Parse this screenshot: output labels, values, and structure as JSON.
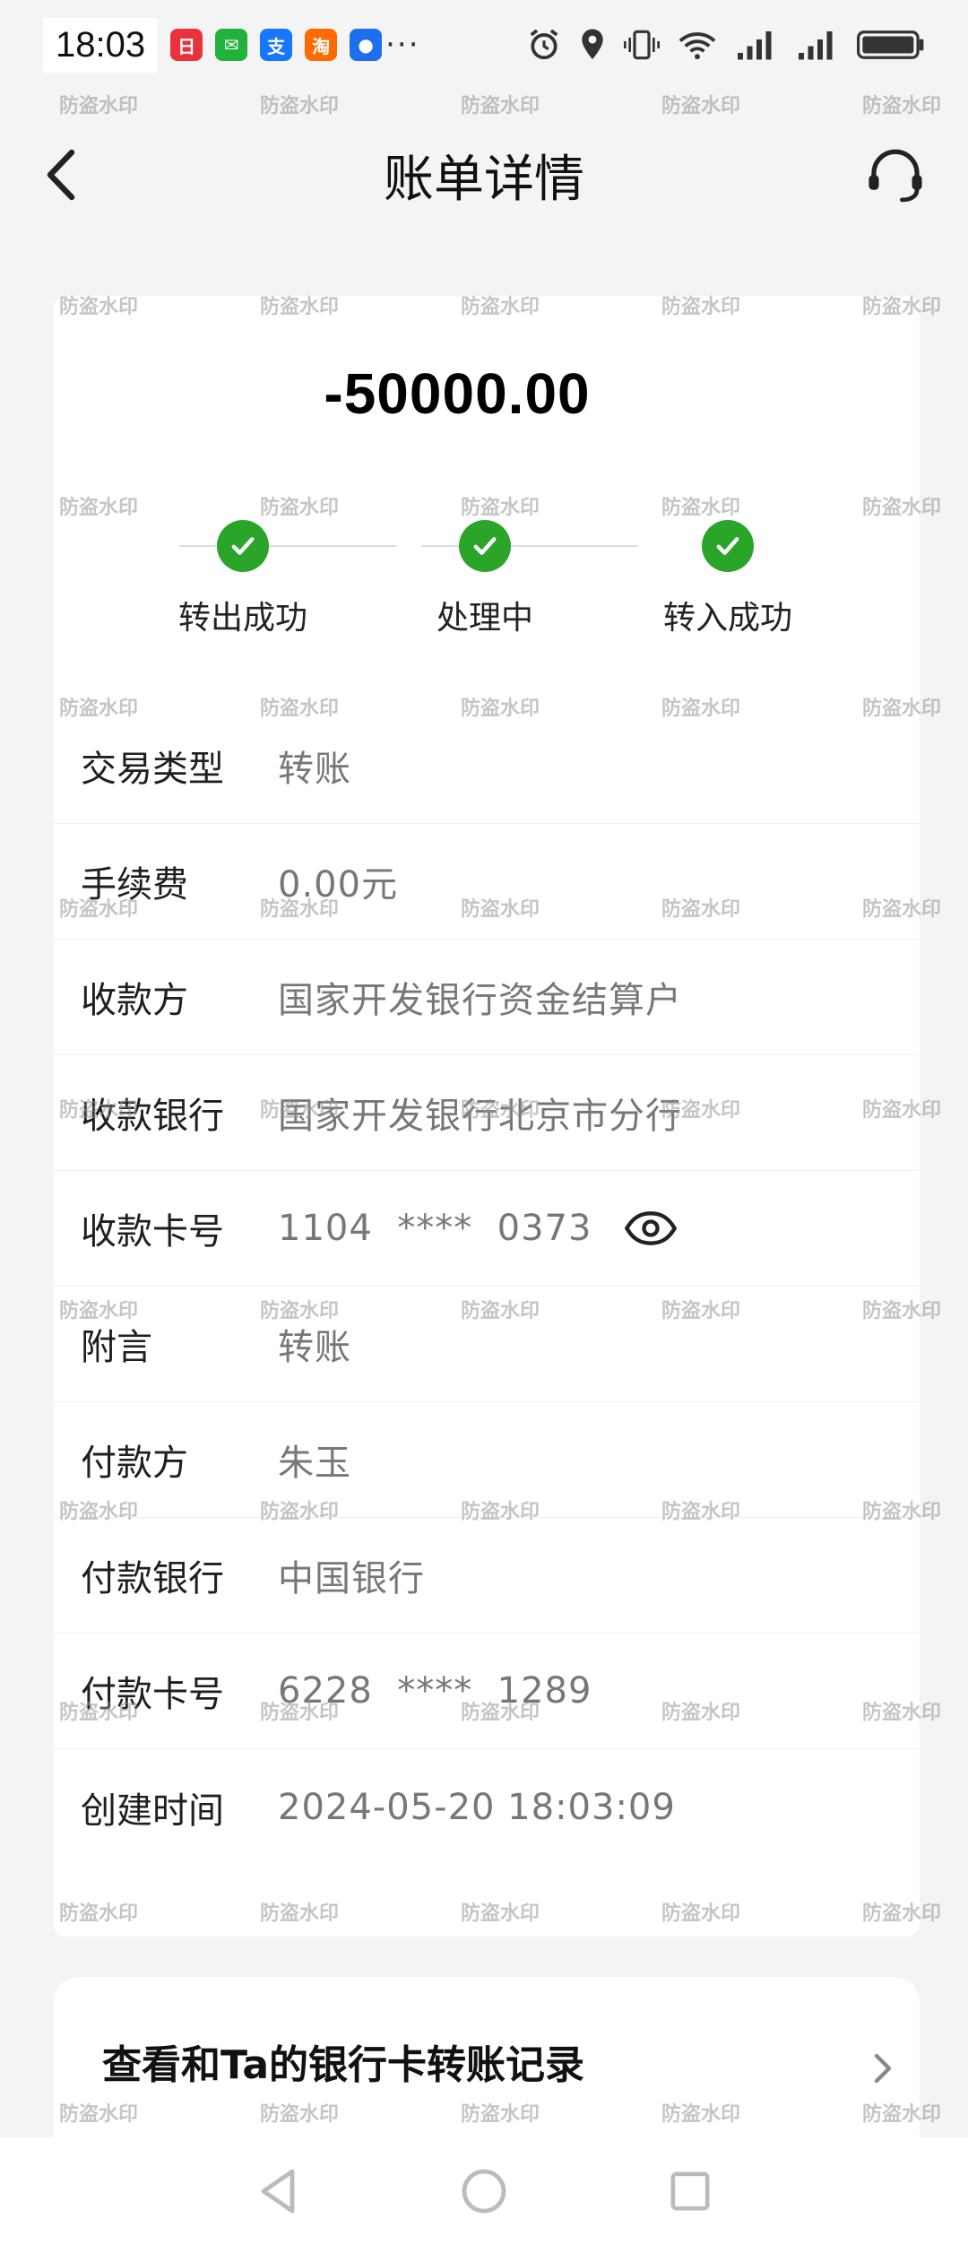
{
  "status_bar": {
    "time": "18:03",
    "app_icons": [
      {
        "name": "mall-app-icon",
        "color": "#e8333a",
        "glyph": "日"
      },
      {
        "name": "wechat-icon",
        "color": "#22b13a",
        "glyph": "✉"
      },
      {
        "name": "alipay-icon",
        "color": "#1677ff",
        "glyph": "支"
      },
      {
        "name": "taobao-icon",
        "color": "#ff6a00",
        "glyph": "淘"
      },
      {
        "name": "assistant-app-icon",
        "color": "#1e6ff0",
        "glyph": "●"
      }
    ],
    "more": "···"
  },
  "header": {
    "title": "账单详情"
  },
  "bill": {
    "amount": "-50000.00",
    "steps": [
      {
        "label": "转出成功"
      },
      {
        "label": "处理中"
      },
      {
        "label": "转入成功"
      }
    ],
    "rows": [
      {
        "label": "交易类型",
        "value": "转账"
      },
      {
        "label": "手续费",
        "value": "0.00元"
      },
      {
        "label": "收款方",
        "value": "国家开发银行资金结算户"
      },
      {
        "label": "收款银行",
        "value": "国家开发银行北京市分行"
      },
      {
        "label": "收款卡号",
        "value": "1104  ****  0373"
      },
      {
        "label": "附言",
        "value": "转账"
      },
      {
        "label": "付款方",
        "value": "朱玉"
      },
      {
        "label": "付款银行",
        "value": "中国银行"
      },
      {
        "label": "付款卡号",
        "value": "6228  ****  1289"
      },
      {
        "label": "创建时间",
        "value": "2024-05-20 18:03:09"
      }
    ]
  },
  "records": {
    "label": "查看和Ta的银行卡转账记录"
  },
  "watermark": {
    "text": "防盗水印"
  },
  "colors": {
    "success_green": "#2aa52a",
    "background": "#f4f4f4"
  }
}
